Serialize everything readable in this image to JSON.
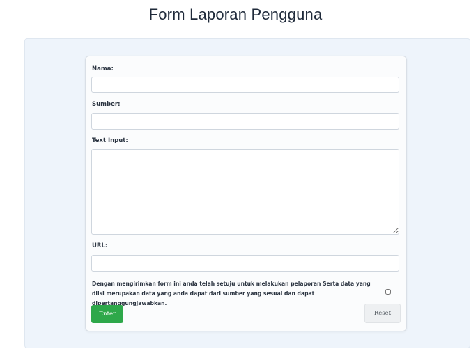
{
  "page": {
    "title": "Form Laporan Pengguna"
  },
  "form": {
    "name_label": "Nama:",
    "name_value": "",
    "source_label": "Sumber:",
    "source_value": "",
    "text_label": "Text Input:",
    "text_value": "",
    "url_label": "URL:",
    "url_value": "",
    "consent_text": "Dengan mengirimkan form ini anda telah setuju untuk melakukan pelaporan Serta data yang diisi merupakan data yang anda dapat dari sumber yang sesuai dan dapat dipertanggungjawabkan.",
    "consent_checked": false,
    "submit_label": "Enter",
    "reset_label": "Reset"
  },
  "colors": {
    "submit_bg": "#2ea84a",
    "reset_bg": "#eef0f2",
    "panel_bg": "#eef4fb"
  }
}
